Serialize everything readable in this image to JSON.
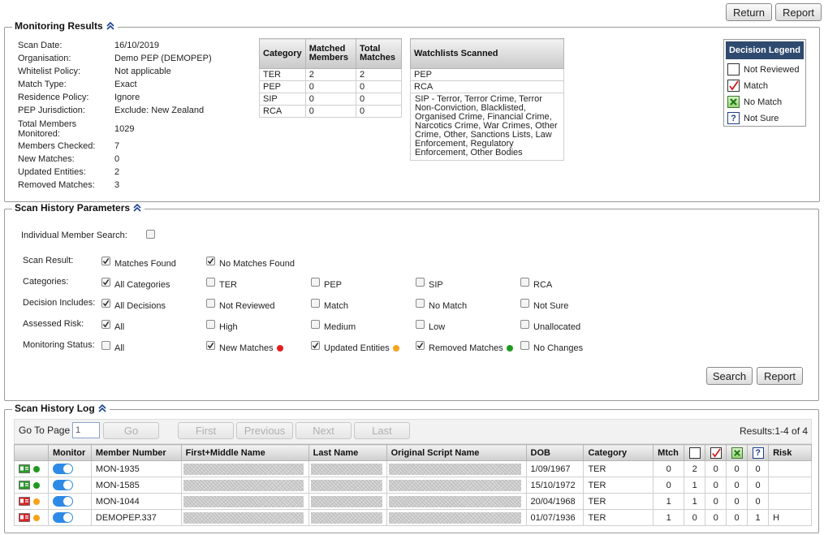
{
  "top_buttons": {
    "return_label": "Return",
    "report_label": "Report"
  },
  "monitoring": {
    "title": "Monitoring Results",
    "fields": [
      {
        "label": "Scan Date:",
        "value": "16/10/2019"
      },
      {
        "label": "Organisation:",
        "value": "Demo PEP (DEMOPEP)"
      },
      {
        "label": "Whitelist Policy:",
        "value": "Not applicable"
      },
      {
        "label": "Match Type:",
        "value": "Exact"
      },
      {
        "label": "Residence Policy:",
        "value": "Ignore"
      },
      {
        "label": "PEP Jurisdiction:",
        "value": "Exclude: New Zealand"
      },
      {
        "label": "Total Members Monitored:",
        "value": "1029"
      },
      {
        "label": "Members Checked:",
        "value": "7"
      },
      {
        "label": "New Matches:",
        "value": "0"
      },
      {
        "label": "Updated Entities:",
        "value": "2"
      },
      {
        "label": "Removed Matches:",
        "value": "3"
      }
    ],
    "category_table": {
      "headers": [
        "Category",
        "Matched Members",
        "Total Matches"
      ],
      "rows": [
        [
          "TER",
          "2",
          "2"
        ],
        [
          "PEP",
          "0",
          "0"
        ],
        [
          "SIP",
          "0",
          "0"
        ],
        [
          "RCA",
          "0",
          "0"
        ]
      ]
    },
    "watchlists": {
      "header": "Watchlists Scanned",
      "rows": [
        "PEP",
        "RCA",
        "SIP - Terror, Terror Crime, Terror Non-Conviction, Blacklisted, Organised Crime, Financial Crime, Narcotics Crime, War Crimes, Other Crime, Other, Sanctions Lists, Law Enforcement, Regulatory Enforcement, Other Bodies"
      ]
    },
    "decision_legend": {
      "title": "Decision Legend",
      "items": [
        "Not Reviewed",
        "Match",
        "No Match",
        "Not Sure"
      ]
    }
  },
  "params": {
    "title": "Scan History Parameters",
    "individual_search_label": "Individual Member Search:",
    "rows": [
      {
        "label": "Scan Result:",
        "options": [
          {
            "text": "Matches Found",
            "checked": true
          },
          {
            "text": "No Matches Found",
            "checked": true
          }
        ]
      },
      {
        "label": "Categories:",
        "options": [
          {
            "text": "All Categories",
            "checked": true
          },
          {
            "text": "TER",
            "checked": false
          },
          {
            "text": "PEP",
            "checked": false
          },
          {
            "text": "SIP",
            "checked": false
          },
          {
            "text": "RCA",
            "checked": false
          }
        ]
      },
      {
        "label": "Decision Includes:",
        "options": [
          {
            "text": "All Decisions",
            "checked": true
          },
          {
            "text": "Not Reviewed",
            "checked": false
          },
          {
            "text": "Match",
            "checked": false
          },
          {
            "text": "No Match",
            "checked": false
          },
          {
            "text": "Not Sure",
            "checked": false
          }
        ]
      },
      {
        "label": "Assessed Risk:",
        "options": [
          {
            "text": "All",
            "checked": true
          },
          {
            "text": "High",
            "checked": false
          },
          {
            "text": "Medium",
            "checked": false
          },
          {
            "text": "Low",
            "checked": false
          },
          {
            "text": "Unallocated",
            "checked": false
          }
        ]
      },
      {
        "label": "Monitoring Status:",
        "options": [
          {
            "text": "All",
            "checked": false
          },
          {
            "text": "New Matches",
            "checked": true,
            "dot": "#e81c1c"
          },
          {
            "text": "Updated Entities",
            "checked": true,
            "dot": "#f7a21b"
          },
          {
            "text": "Removed Matches",
            "checked": true,
            "dot": "#1f9a1f"
          },
          {
            "text": "No Changes",
            "checked": false
          }
        ]
      }
    ],
    "search_label": "Search",
    "report_label": "Report"
  },
  "log": {
    "title": "Scan History Log",
    "goto_label": "Go To Page",
    "page_value": "1",
    "go_label": "Go",
    "first_label": "First",
    "previous_label": "Previous",
    "next_label": "Next",
    "last_label": "Last",
    "results_label": "Results:",
    "results_value": "1-4 of 4",
    "headers": [
      "",
      "Monitor",
      "Member Number",
      "First+Middle Name",
      "Last Name",
      "Original Script Name",
      "DOB",
      "Category",
      "Mtch",
      "",
      "",
      "",
      "",
      "Risk"
    ],
    "rows": [
      {
        "status": "green",
        "member": "MON-1935",
        "dob": "1/09/1967",
        "category": "TER",
        "mtch": "0",
        "d1": "2",
        "d2": "0",
        "d3": "0",
        "d4": "0",
        "risk": ""
      },
      {
        "status": "green",
        "member": "MON-1585",
        "dob": "15/10/1972",
        "category": "TER",
        "mtch": "0",
        "d1": "1",
        "d2": "0",
        "d3": "0",
        "d4": "0",
        "risk": ""
      },
      {
        "status": "orange",
        "member": "MON-1044",
        "dob": "20/04/1968",
        "category": "TER",
        "mtch": "1",
        "d1": "1",
        "d2": "0",
        "d3": "0",
        "d4": "0",
        "risk": ""
      },
      {
        "status": "orange",
        "member": "DEMOPEP.337",
        "dob": "01/07/1936",
        "category": "TER",
        "mtch": "1",
        "d1": "0",
        "d2": "0",
        "d3": "0",
        "d4": "1",
        "risk": "H"
      }
    ]
  },
  "colors": {
    "legend_header": "#2f4a6e",
    "toggle": "#2e8ae6",
    "green_dot": "#1f9a1f",
    "orange_dot": "#f7a21b",
    "red_dot": "#e81c1c"
  }
}
